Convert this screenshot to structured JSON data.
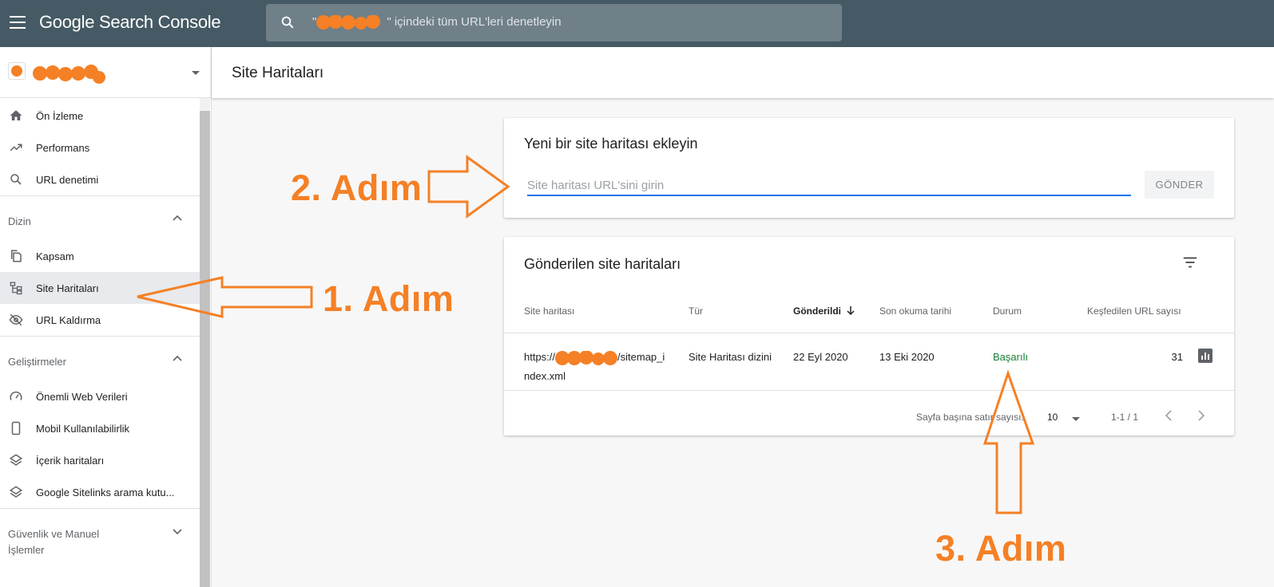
{
  "app": {
    "title": "Google Search Console"
  },
  "search": {
    "placeholder_suffix": "\" içindeki tüm URL'leri denetleyin",
    "quote_open": "\""
  },
  "sidebar": {
    "items_top": [
      {
        "label": "Ön İzleme",
        "icon": "home-icon"
      },
      {
        "label": "Performans",
        "icon": "trending-up-icon"
      },
      {
        "label": "URL denetimi",
        "icon": "search-icon"
      }
    ],
    "section_index": {
      "label": "Dizin"
    },
    "items_index": [
      {
        "label": "Kapsam",
        "icon": "copy-icon"
      },
      {
        "label": "Site Haritaları",
        "icon": "sitemap-icon",
        "active": true
      },
      {
        "label": "URL Kaldırma",
        "icon": "eye-off-icon"
      }
    ],
    "section_enh": {
      "label": "Geliştirmeler"
    },
    "items_enh": [
      {
        "label": "Önemli Web Verileri",
        "icon": "speed-icon"
      },
      {
        "label": "Mobil Kullanılabilirlik",
        "icon": "phone-icon"
      },
      {
        "label": "İçerik haritaları",
        "icon": "layers-icon"
      },
      {
        "label": "Google Sitelinks arama kutu...",
        "icon": "layers-icon"
      }
    ],
    "section_security": {
      "label_line1": "Güvenlik ve Manuel",
      "label_line2": "İşlemler"
    }
  },
  "page": {
    "title": "Site Haritaları"
  },
  "add_card": {
    "title": "Yeni bir site haritası ekleyin",
    "input_placeholder": "Site haritası URL'sini girin",
    "submit_label": "GÖNDER"
  },
  "submitted_card": {
    "title": "Gönderilen site haritaları",
    "columns": [
      "Site haritası",
      "Tür",
      "Gönderildi",
      "Son okuma tarihi",
      "Durum",
      "Keşfedilen URL sayısı"
    ],
    "row": {
      "url_prefix": "https://",
      "url_suffix_line1": "/sitemap_i",
      "url_line2": "ndex.xml",
      "type": "Site Haritası dizini",
      "submitted": "22 Eyl 2020",
      "last_read": "13 Eki 2020",
      "status": "Başarılı",
      "discovered": "31"
    },
    "footer": {
      "rows_label": "Sayfa başına satır sayısı:",
      "rows_value": "10",
      "range": "1-1 / 1"
    }
  },
  "annotations": {
    "step1": "1. Adım",
    "step2": "2. Adım",
    "step3": "3. Adım",
    "color": "#f58025"
  },
  "colors": {
    "topbar": "#455a64",
    "accent_blue": "#1a73e8",
    "success_green": "#188038",
    "annotation_orange": "#f58025"
  }
}
